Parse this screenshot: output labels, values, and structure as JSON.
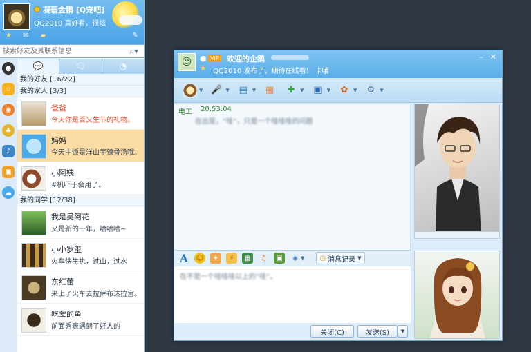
{
  "qq_main": {
    "self": {
      "name": "凝碧金鹏 [Q宠吧]",
      "signature": "QQ2010 真好看，很炫"
    },
    "search": {
      "placeholder": "搜索好友及其联系信息"
    },
    "groups": [
      {
        "title": "我的好友 [16/22]",
        "contacts": []
      },
      {
        "title": "我的家人 [3/3]",
        "contacts": [
          {
            "name": "爸爸",
            "signature": "今天你是否又生节的礼物。",
            "highlight": true
          },
          {
            "name": "妈妈",
            "signature": "今天中饭是洋山芋辣骨汤哦。",
            "selected": true
          },
          {
            "name": "小阿姨",
            "signature": "#机吓于会用了。"
          }
        ]
      },
      {
        "title": "我的同学 [12/38]",
        "contacts": [
          {
            "name": "我是吴阿花",
            "signature": "又是新的一年，哈哈哈~"
          },
          {
            "name": "小小罗玺",
            "signature": "火车快生执，过山，过水"
          },
          {
            "name": "东红蕾",
            "signature": "来上了火车去拉萨布达拉宫。"
          },
          {
            "name": "吃荤的鱼",
            "signature": "前面秀表遇到了好人的"
          }
        ]
      }
    ]
  },
  "chat_window": {
    "peer": {
      "badge": "VIP",
      "name": "欢迎的企鹅",
      "signature": "QQ2010 发布了，期待在线看！ 卡哦"
    },
    "messages": [
      {
        "sender": "电工",
        "time": "20:53:04",
        "text": "在出是，“哇”，只是一个哇哇哇的问题"
      }
    ],
    "input_text": "在不是一个哇哇哇以上的“哇”。",
    "history_label": "消息记录",
    "buttons": {
      "close": "关闭(C)",
      "send": "发送(S)"
    }
  },
  "icons": {
    "search": "search-icon",
    "window_close": "close-icon",
    "window_min": "minimize-icon"
  }
}
